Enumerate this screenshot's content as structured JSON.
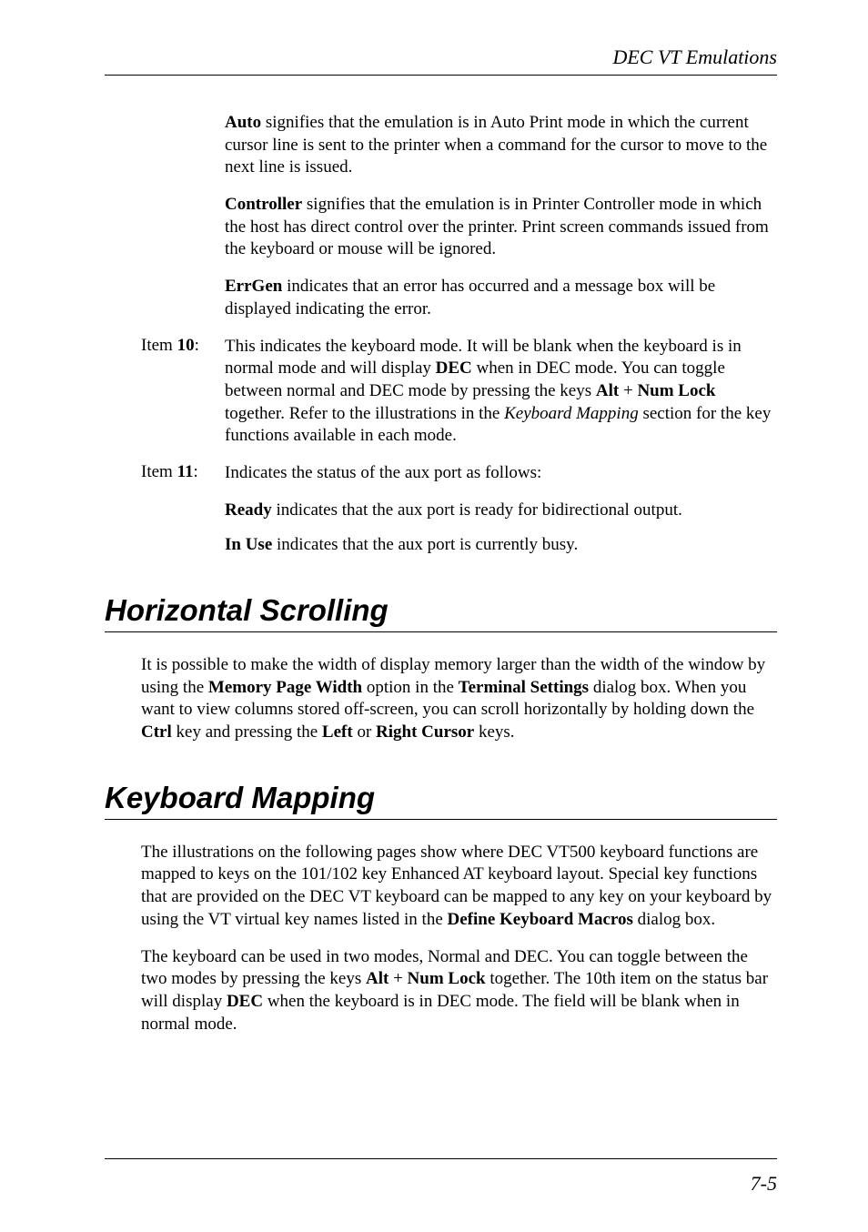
{
  "header": {
    "title": "DEC VT Emulations"
  },
  "topBlock": {
    "para1": {
      "bold1": "Auto",
      "text1": " signifies that the emulation is in Auto Print mode in which the current cursor line is sent to the printer when a command for the cursor to move to the next line is issued."
    },
    "para2": {
      "bold1": "Controller",
      "text1": " signifies that the emulation is in Printer Controller mode in which the host has direct control over the printer. Print screen commands issued from the keyboard or mouse will be ignored."
    },
    "para3": {
      "bold1": "ErrGen",
      "text1": " indicates that an error has occurred and a message box will be displayed indicating the error."
    }
  },
  "item10": {
    "labelPrefix": "Item ",
    "labelBold": "10",
    "labelSuffix": ":",
    "text1": "This indicates the keyboard mode. It will be blank when the keyboard is in normal mode and will display ",
    "bold1": "DEC",
    "text2": " when in DEC mode. You can toggle between normal and DEC mode by pressing the keys ",
    "bold2": "Alt",
    "text3": " + ",
    "bold3": "Num Lock",
    "text4": " together. Refer to the illustrations in the ",
    "ital1": "Keyboard Mapping",
    "text5": " section for the key functions available in each mode."
  },
  "item11": {
    "labelPrefix": "Item ",
    "labelBold": "11",
    "labelSuffix": ":",
    "text1": "Indicates the status of the aux port as follows:",
    "sub1bold": "Ready",
    "sub1text": " indicates that the aux port is ready for bidirectional output.",
    "sub2bold": "In Use",
    "sub2text": " indicates that the aux port is currently busy."
  },
  "section1": {
    "heading": "Horizontal Scrolling",
    "text1": "It is possible to make the width of display memory larger than the width of the window by using the ",
    "bold1": "Memory Page Width",
    "text2": " option in the ",
    "bold2": "Terminal Settings",
    "text3": " dialog box. When you want to view columns stored off-screen, you can scroll horizontally by holding down the ",
    "bold3": "Ctrl",
    "text4": " key and pressing the ",
    "bold4": "Left",
    "text5": " or ",
    "bold5": "Right Cursor",
    "text6": " keys."
  },
  "section2": {
    "heading": "Keyboard Mapping",
    "para1": {
      "text1": "The illustrations on the following pages show where DEC VT500 keyboard functions are mapped to keys on the 101/102 key Enhanced AT keyboard layout. Special key functions that are provided on the DEC VT keyboard can be mapped to any key on your keyboard by using the VT virtual key names listed in the ",
      "bold1": "Define Keyboard Macros",
      "text2": " dialog box."
    },
    "para2": {
      "text1": "The keyboard can be used in two modes, Normal and DEC. You can toggle between the two modes by pressing the keys ",
      "bold1": "Alt",
      "text2": " + ",
      "bold2": "Num Lock",
      "text3": " together. The 10th item on the status bar will display ",
      "bold3": "DEC",
      "text4": " when the keyboard is in DEC mode. The field will be blank when in normal mode."
    }
  },
  "footer": {
    "pageNumber": "7-5"
  }
}
